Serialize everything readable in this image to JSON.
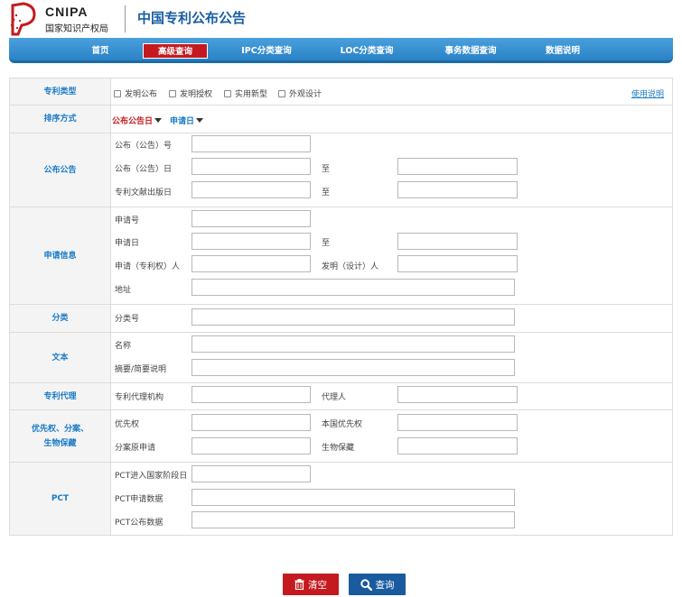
{
  "header": {
    "logo_en": "CNIPA",
    "logo_cn": "国家知识产权局",
    "title": "中国专利公布公告"
  },
  "nav": {
    "items": [
      "首页",
      "高级查询",
      "IPC分类查询",
      "LOC分类查询",
      "事务数据查询",
      "数据说明"
    ],
    "active": "高级查询"
  },
  "form": {
    "patent_type": {
      "label": "专利类型",
      "options": [
        "发明公布",
        "发明授权",
        "实用新型",
        "外观设计"
      ],
      "help_link": "使用说明"
    },
    "sort": {
      "label": "排序方式",
      "options": [
        "公布公告日",
        "申请日"
      ]
    },
    "publication": {
      "label": "公布公告",
      "pub_no": "公布（公告）号",
      "pub_date": "公布（公告）日",
      "doc_date": "专利文献出版日",
      "to": "至"
    },
    "application": {
      "label": "申请信息",
      "app_no": "申请号",
      "app_date": "申请日",
      "to": "至",
      "applicant": "申请（专利权）人",
      "inventor": "发明（设计）人",
      "address": "地址"
    },
    "classification": {
      "label": "分类",
      "class_no": "分类号"
    },
    "text": {
      "label": "文本",
      "name": "名称",
      "abstract": "摘要/简要说明"
    },
    "agency": {
      "label": "专利代理",
      "agency": "专利代理机构",
      "agent": "代理人"
    },
    "priority": {
      "label_line1": "优先权、分案、",
      "label_line2": "生物保藏",
      "priority": "优先权",
      "domestic_priority": "本国优先权",
      "divisional": "分案原申请",
      "bio_deposit": "生物保藏"
    },
    "pct": {
      "label": "PCT",
      "entry_date": "PCT进入国家阶段日",
      "app_data": "PCT申请数据",
      "pub_data": "PCT公布数据"
    }
  },
  "buttons": {
    "clear": "清空",
    "query": "查询"
  },
  "colors": {
    "nav_blue": "#2a82c6",
    "active_red": "#c41a1f",
    "label_blue": "#1a7bc7",
    "sort_active_red": "#c41a1f",
    "query_blue": "#1a5a9e"
  }
}
